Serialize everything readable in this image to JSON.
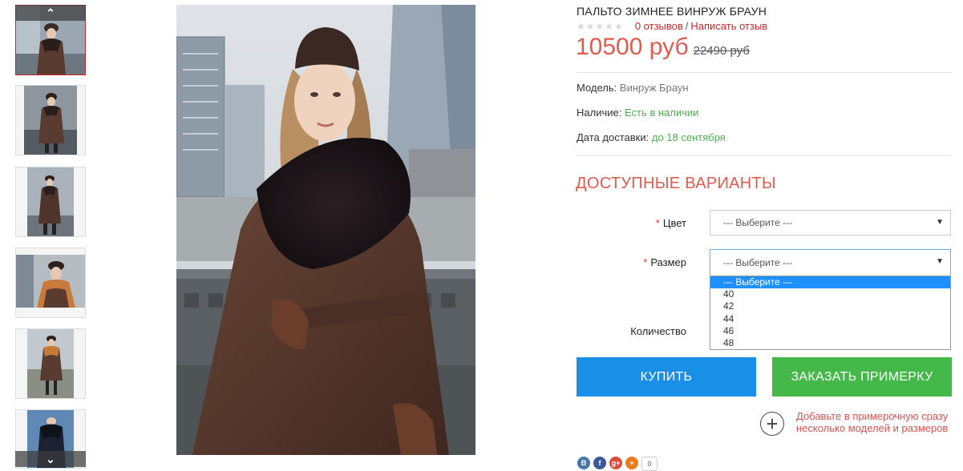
{
  "colors": {
    "accent": "#e05a4e",
    "link": "#c62828",
    "in_stock": "#4caf50",
    "buy_button": "#1a8fe8",
    "tryon_button": "#44b94a",
    "dropdown_highlight": "#1e90ff"
  },
  "gallery": {
    "up_icon": "chevron-up-icon",
    "down_icon": "chevron-down-icon",
    "thumbnail_count": 6,
    "active_index": 0
  },
  "product": {
    "title": "ПАЛЬТО ЗИМНЕЕ ВИНРУЖ БРАУН",
    "rating_stars": 0,
    "reviews_link": "0 отзывов",
    "rating_separator": "/",
    "write_review_link": "Написать отзыв",
    "price_new": "10500 руб",
    "price_old": "22490 руб",
    "model_label": "Модель:",
    "model_value": "Винруж Браун",
    "stock_label": "Наличие:",
    "stock_value": "Есть в наличии",
    "delivery_label": "Дата доставки:",
    "delivery_value": "до 18 сентября"
  },
  "options": {
    "heading": "ДОСТУПНЫЕ ВАРИАНТЫ",
    "required_mark": "*",
    "color_label": "Цвет",
    "color_value": "--- Выберите ---",
    "size_label": "Размер",
    "size_value": "--- Выберите ---",
    "size_options": [
      "--- Выберите ---",
      "40",
      "42",
      "44",
      "46",
      "48"
    ],
    "size_highlighted": "--- Выберите ---",
    "quantity_label": "Количество"
  },
  "actions": {
    "buy_label": "КУПИТЬ",
    "tryon_label": "ЗАКАЗАТЬ ПРИМЕРКУ",
    "add_fitting_text": "Добавьте в примерочную сразу несколько моделей и размеров",
    "add_fitting_icon": "plus-circle-icon"
  },
  "social": {
    "buttons": [
      {
        "name": "vk",
        "glyph": "B",
        "color": "#4a76a8"
      },
      {
        "name": "facebook",
        "glyph": "f",
        "color": "#3b5998"
      },
      {
        "name": "google-plus",
        "glyph": "g+",
        "color": "#dd4b39"
      },
      {
        "name": "share",
        "glyph": "+",
        "color": "#e87c1e"
      }
    ],
    "count": "0"
  }
}
